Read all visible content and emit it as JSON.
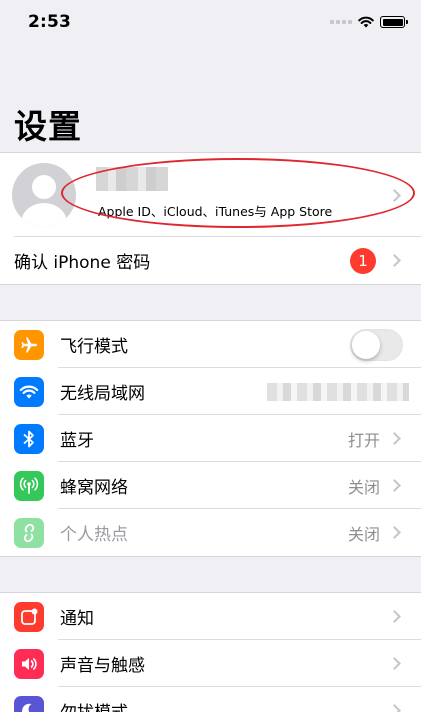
{
  "status_bar": {
    "time": "2:53"
  },
  "title": "设置",
  "profile": {
    "subtitle": "Apple ID、iCloud、iTunes与 App Store"
  },
  "confirm_row": {
    "label": "确认 iPhone 密码",
    "badge": "1"
  },
  "connectivity": [
    {
      "label": "飞行模式",
      "icon": "airplane-icon",
      "color": "#ff9500",
      "value": "",
      "toggle": false
    },
    {
      "label": "无线局域网",
      "icon": "wifi-icon",
      "color": "#007aff",
      "value": ""
    },
    {
      "label": "蓝牙",
      "icon": "bluetooth-icon",
      "color": "#007aff",
      "value": "打开"
    },
    {
      "label": "蜂窝网络",
      "icon": "cellular-icon",
      "color": "#34c759",
      "value": "关闭"
    },
    {
      "label": "个人热点",
      "icon": "hotspot-icon",
      "color": "#34c759",
      "value": "关闭",
      "disabled": true
    }
  ],
  "notifications": [
    {
      "label": "通知",
      "icon": "notifications-icon",
      "color": "#ff3b30"
    },
    {
      "label": "声音与触感",
      "icon": "sounds-icon",
      "color": "#ff2d55"
    },
    {
      "label": "勿扰模式",
      "icon": "moon-icon",
      "color": "#5856d6"
    }
  ]
}
